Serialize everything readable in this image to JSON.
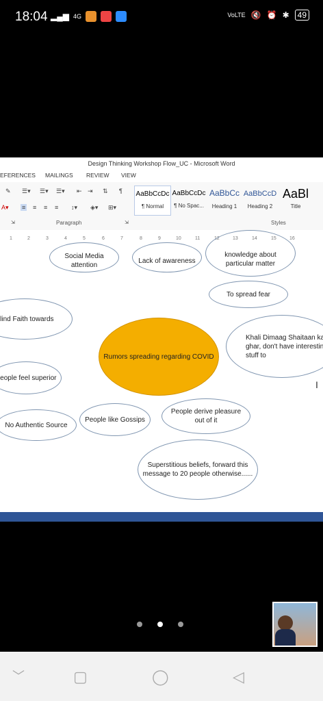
{
  "status_bar": {
    "time": "18:04",
    "network": "4G",
    "volte": "VoLTE",
    "battery": "49"
  },
  "window": {
    "title": "Design Thinking Workshop Flow_UC - Microsoft Word"
  },
  "ribbon": {
    "tabs": [
      "EFERENCES",
      "MAILINGS",
      "REVIEW",
      "VIEW"
    ],
    "groups": {
      "paragraph": "Paragraph",
      "styles": "Styles"
    },
    "styles": [
      {
        "preview": "AaBbCcDc",
        "name": "¶ Normal"
      },
      {
        "preview": "AaBbCcDc",
        "name": "¶ No Spac..."
      },
      {
        "preview": "AaBbCc",
        "name": "Heading 1"
      },
      {
        "preview": "AaBbCcD",
        "name": "Heading 2"
      },
      {
        "preview": "AaBl",
        "name": "Title"
      }
    ]
  },
  "ruler": [
    "1",
    "2",
    "3",
    "4",
    "5",
    "6",
    "7",
    "8",
    "9",
    "10",
    "11",
    "12",
    "13",
    "14",
    "15",
    "16"
  ],
  "diagram": {
    "center": "Rumors spreading regarding COVID",
    "bubbles": [
      "Social Media attention",
      "Lack of awareness",
      "knowledge about particular matter",
      "To spread fear",
      "Blind Faith towards",
      "Khali Dimaag Shaitaan ka ghar, don't have interesting stuff to",
      "People feel superior",
      "No Authentic Source",
      "People like Gossips",
      "People derive pleasure out of it",
      "Superstitious beliefs, forward this message to 20 people otherwise......"
    ]
  }
}
